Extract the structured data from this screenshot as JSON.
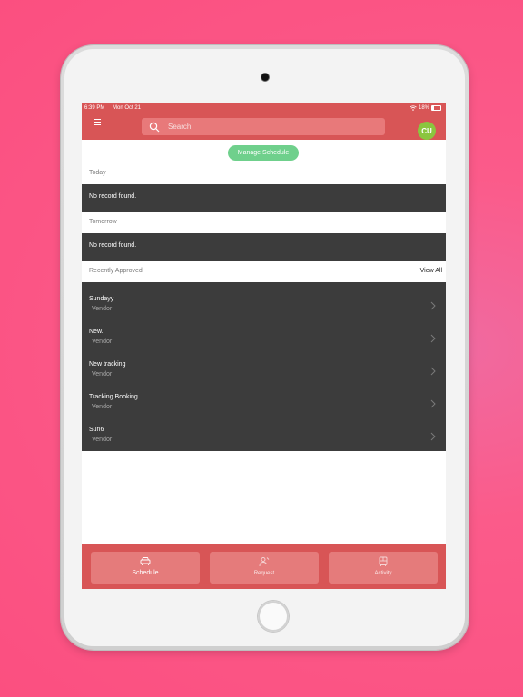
{
  "status_bar": {
    "time": "6:39 PM",
    "date": "Mon Oct 21",
    "battery": "18%"
  },
  "header": {
    "search_placeholder": "Search",
    "avatar_initials": "CU"
  },
  "manage_schedule_label": "Manage Schedule",
  "sections": {
    "today": {
      "label": "Today",
      "empty_text": "No record found."
    },
    "tomorrow": {
      "label": "Tomorrow",
      "empty_text": "No record found."
    },
    "recently_approved": {
      "label": "Recently Approved",
      "view_all_label": "View All",
      "items": [
        {
          "title": "Sundayy",
          "subtitle": "Vendor"
        },
        {
          "title": "New.",
          "subtitle": "Vendor"
        },
        {
          "title": "New tracking",
          "subtitle": "Vendor"
        },
        {
          "title": "Tracking Booking",
          "subtitle": "Vendor"
        },
        {
          "title": "Sun6",
          "subtitle": "Vendor"
        }
      ]
    }
  },
  "bottom_tabs": [
    {
      "label": "Schedule",
      "icon": "car-icon",
      "active": true
    },
    {
      "label": "Request",
      "icon": "person-request-icon",
      "active": false
    },
    {
      "label": "Activity",
      "icon": "bus-icon",
      "active": false
    }
  ],
  "colors": {
    "header": "#d85556",
    "accent_green": "#6fd08c",
    "avatar": "#8bc53f",
    "dark_rows": "#3c3c3c",
    "background": "#fb5b8a"
  }
}
